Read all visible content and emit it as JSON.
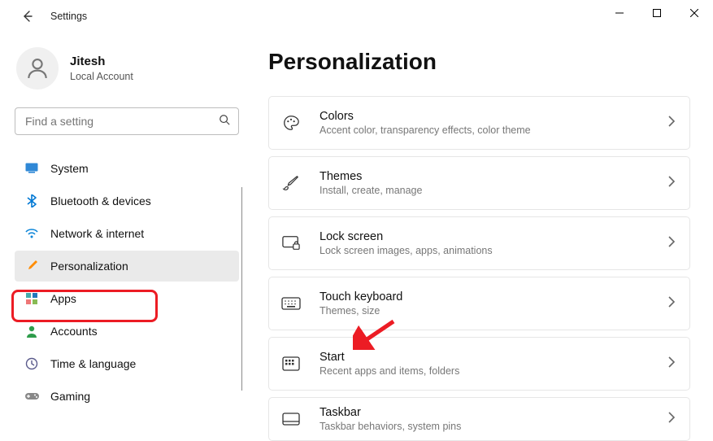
{
  "titlebar": {
    "title": "Settings"
  },
  "user": {
    "name": "Jitesh",
    "sub": "Local Account"
  },
  "search": {
    "placeholder": "Find a setting"
  },
  "nav": {
    "items": [
      {
        "label": "System"
      },
      {
        "label": "Bluetooth & devices"
      },
      {
        "label": "Network & internet"
      },
      {
        "label": "Personalization"
      },
      {
        "label": "Apps"
      },
      {
        "label": "Accounts"
      },
      {
        "label": "Time & language"
      },
      {
        "label": "Gaming"
      }
    ],
    "selected_index": 3
  },
  "page": {
    "title": "Personalization"
  },
  "cards": [
    {
      "title": "Colors",
      "sub": "Accent color, transparency effects, color theme"
    },
    {
      "title": "Themes",
      "sub": "Install, create, manage"
    },
    {
      "title": "Lock screen",
      "sub": "Lock screen images, apps, animations"
    },
    {
      "title": "Touch keyboard",
      "sub": "Themes, size"
    },
    {
      "title": "Start",
      "sub": "Recent apps and items, folders"
    },
    {
      "title": "Taskbar",
      "sub": "Taskbar behaviors, system pins"
    }
  ],
  "annotations": {
    "highlight_nav_index": 3,
    "arrow_card_index": 4
  }
}
